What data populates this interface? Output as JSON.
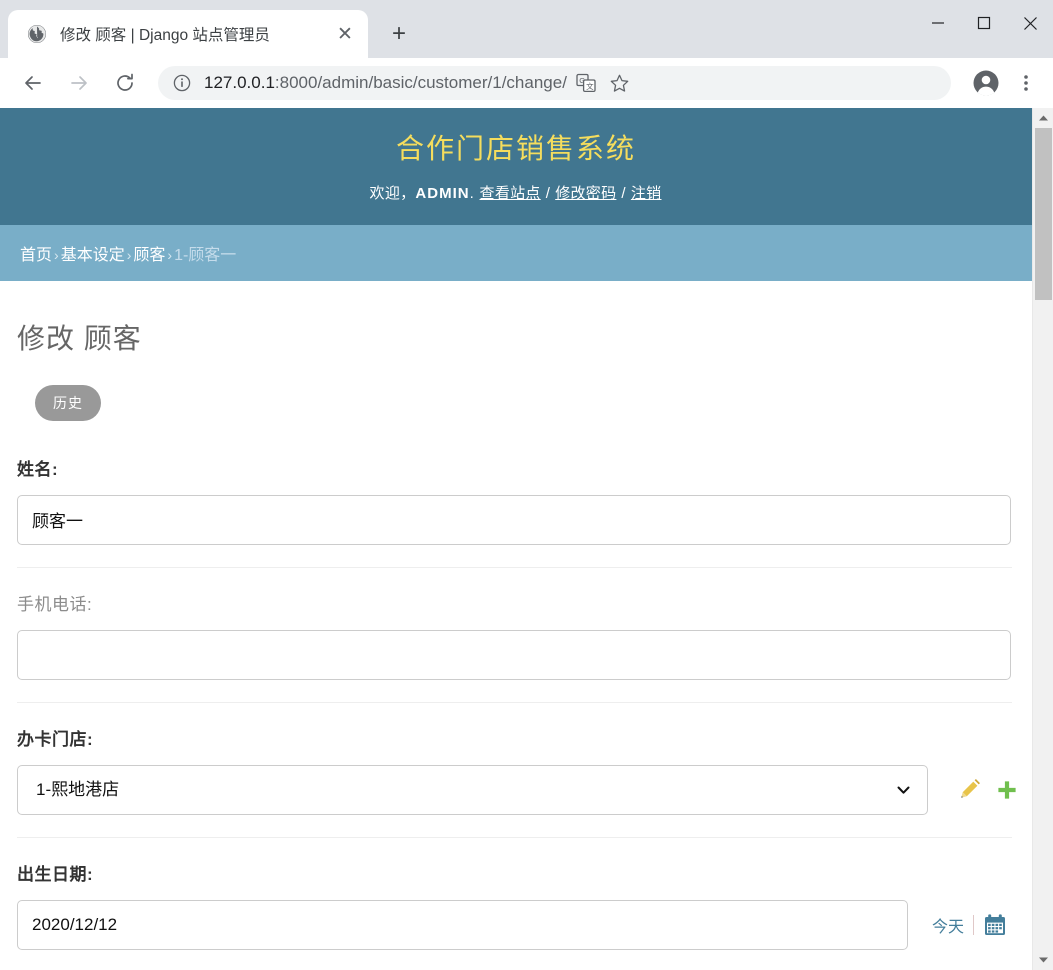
{
  "browser": {
    "tab": {
      "title": "修改 顾客 | Django 站点管理员",
      "favicon": "globe-icon",
      "close_label": "✕"
    },
    "new_tab_label": "+",
    "window_controls": {
      "minimize": "—",
      "maximize": "□",
      "close": "✕"
    },
    "nav": {
      "back": "←",
      "forward": "→",
      "reload": "⟳"
    },
    "omnibox": {
      "info_icon": "site-info-icon",
      "url_host": "127.0.0.1",
      "url_path": ":8000/admin/basic/customer/1/change/",
      "translate_icon": "translate-icon",
      "bookmark_icon": "star-icon"
    },
    "profile_icon": "account-avatar-icon",
    "menu_icon": "three-dot-menu-icon"
  },
  "site": {
    "branding": "合作门店销售系统",
    "welcome_prefix": "欢迎，",
    "username": "ADMIN",
    "welcome_suffix": ".",
    "links": {
      "view_site": "查看站点",
      "change_password": "修改密码",
      "logout": "注销"
    },
    "separator": "/"
  },
  "breadcrumbs": {
    "arrow": "›",
    "items": [
      {
        "label": "首页",
        "current": false
      },
      {
        "label": "基本设定",
        "current": false
      },
      {
        "label": "顾客",
        "current": false
      },
      {
        "label": "1-顾客一",
        "current": true
      }
    ]
  },
  "page": {
    "title": "修改 顾客",
    "object_tools": {
      "history": "历史"
    }
  },
  "form": {
    "fields": [
      {
        "label": "姓名:",
        "required": true,
        "type": "text",
        "value": "顾客一",
        "placeholder": ""
      },
      {
        "label": "手机电话:",
        "required": false,
        "type": "text",
        "value": "",
        "placeholder": ""
      },
      {
        "label": "办卡门店:",
        "required": true,
        "type": "select",
        "value": "1-熙地港店",
        "options": [
          "1-熙地港店"
        ],
        "related_widgets": [
          {
            "name": "change-related-icon",
            "title": "修改"
          },
          {
            "name": "add-related-icon",
            "title": "增加"
          }
        ]
      },
      {
        "label": "出生日期:",
        "required": true,
        "type": "date",
        "value": "2020/12/12",
        "today_label": "今天",
        "calendar_icon": "calendar-icon"
      }
    ]
  },
  "colors": {
    "header_bg": "#417690",
    "breadcrumb_bg": "#79aec8",
    "branding": "#f5dd5d",
    "link": "#447e9b",
    "history_btn": "#999999",
    "edit_icon": "#e8c44a",
    "add_icon": "#70bf4e"
  }
}
